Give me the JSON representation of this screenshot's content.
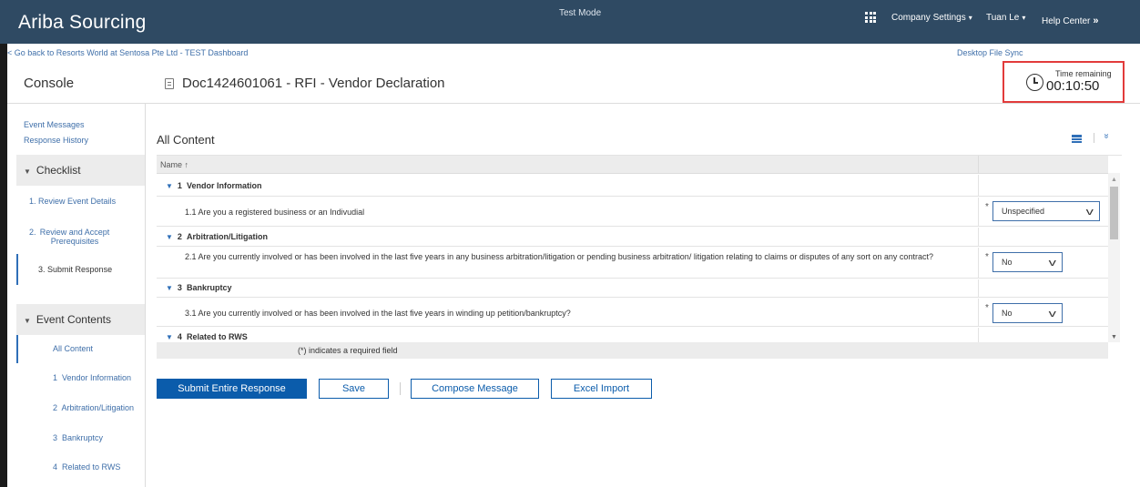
{
  "header": {
    "brand": "Ariba Sourcing",
    "mode": "Test Mode",
    "menus": [
      {
        "label": "Company Settings",
        "caret": "▾"
      },
      {
        "label": "Tuan Le",
        "caret": "▾"
      },
      {
        "label": "Help Center",
        "caret": "»"
      }
    ]
  },
  "nav": {
    "back_link": "< Go back to Resorts World at Sentosa Pte Ltd - TEST Dashboard",
    "desktop_sync": "Desktop File Sync"
  },
  "page": {
    "console_title": "Console",
    "doc_title": "Doc1424601061 - RFI - Vendor Declaration"
  },
  "timer": {
    "label": "Time remaining",
    "value": "00:10:50"
  },
  "sidebar": {
    "links": [
      "Event Messages",
      "Response History"
    ],
    "checklist": {
      "title": "Checklist",
      "items": [
        {
          "num": "1.",
          "label": "Review Event Details"
        },
        {
          "num": "2.",
          "label": "Review and Accept Prerequisites"
        },
        {
          "num": "3.",
          "label": "Submit Response"
        }
      ]
    },
    "event_contents": {
      "title": "Event Contents",
      "items": [
        {
          "label": "All Content"
        },
        {
          "label": "1  Vendor Information"
        },
        {
          "label": "2  Arbitration/Litigation"
        },
        {
          "label": "3  Bankruptcy"
        },
        {
          "label": "4  Related to RWS"
        }
      ]
    }
  },
  "content": {
    "title": "All Content",
    "column_name": "Name ↑",
    "sections": [
      {
        "num": "1",
        "title": "Vendor Information",
        "question": "1.1  Are you a registered business or an Indivudial",
        "answer": "Unspecified"
      },
      {
        "num": "2",
        "title": "Arbitration/Litigation",
        "question": "2.1  Are you currently involved or has been involved in the last five years in any business arbitration/litigation or pending business arbitration/ litigation relating to claims or disputes of any sort on any contract?",
        "answer": "No"
      },
      {
        "num": "3",
        "title": "Bankruptcy",
        "question": "3.1  Are you currently involved or has been involved in the last five years in winding up petition/bankruptcy?",
        "answer": "No"
      },
      {
        "num": "4",
        "title": "Related to RWS"
      }
    ],
    "required_star": "*",
    "required_note": "(*) indicates a required field"
  },
  "actions": {
    "submit": "Submit Entire Response",
    "save": "Save",
    "compose": "Compose Message",
    "excel": "Excel Import"
  }
}
